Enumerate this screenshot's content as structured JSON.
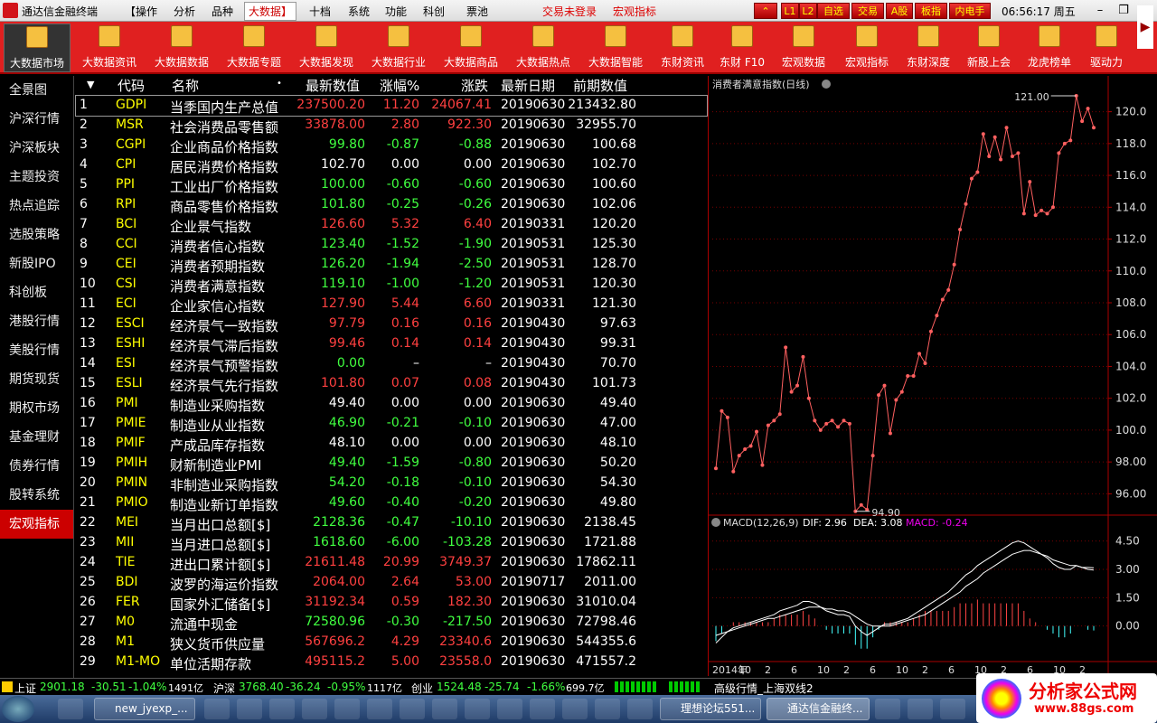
{
  "titlebar": {
    "title": "通达信金融终端",
    "menus": [
      "【操作",
      "分析",
      "品种",
      "大数据】",
      "十档",
      "系统",
      "功能",
      "科创",
      "票池"
    ],
    "login_status": "交易未登录",
    "macro_label": "宏观指标",
    "buttons": [
      "⌃",
      "L1",
      "L2",
      "自选",
      "交易",
      "A股",
      "板指",
      "内电手"
    ],
    "clock": "06:56:17",
    "weekday": "周五"
  },
  "toolbar": {
    "items": [
      "大数据市场",
      "大数据资讯",
      "大数据数据",
      "大数据专题",
      "大数据发现",
      "大数据行业",
      "大数据商品",
      "大数据热点",
      "大数据智能",
      "东财资讯",
      "东财 F10",
      "宏观数据",
      "宏观指标",
      "东财深度",
      "新股上会",
      "龙虎榜单",
      "驱动力"
    ]
  },
  "sidebar": {
    "items": [
      "全景图",
      "沪深行情",
      "沪深板块",
      "主题投资",
      "热点追踪",
      "选股策略",
      "新股IPO",
      "科创板",
      "港股行情",
      "美股行情",
      "期货现货",
      "期权市场",
      "基金理财",
      "债券行情",
      "股转系统",
      "宏观指标"
    ],
    "active_index": 15
  },
  "table": {
    "headers": {
      "sort": "▼",
      "code": "代码",
      "name": "名称",
      "dot": "•",
      "value": "最新数值",
      "pct": "涨幅%",
      "chg": "涨跌",
      "date": "最新日期",
      "prev": "前期数值"
    },
    "rows": [
      {
        "no": "1",
        "code": "GDPI",
        "name": "当季国内生产总值",
        "value": "237500.20",
        "pct": "11.20",
        "chg": "24067.41",
        "date": "20190630",
        "prev": "213432.80",
        "dir": "up"
      },
      {
        "no": "2",
        "code": "MSR",
        "name": "社会消费品零售额",
        "value": "33878.00",
        "pct": "2.80",
        "chg": "922.30",
        "date": "20190630",
        "prev": "32955.70",
        "dir": "up"
      },
      {
        "no": "3",
        "code": "CGPI",
        "name": "企业商品价格指数",
        "value": "99.80",
        "pct": "-0.87",
        "chg": "-0.88",
        "date": "20190630",
        "prev": "100.68",
        "dir": "dn"
      },
      {
        "no": "4",
        "code": "CPI",
        "name": "居民消费价格指数",
        "value": "102.70",
        "pct": "0.00",
        "chg": "0.00",
        "date": "20190630",
        "prev": "102.70",
        "dir": "fl"
      },
      {
        "no": "5",
        "code": "PPI",
        "name": "工业出厂价格指数",
        "value": "100.00",
        "pct": "-0.60",
        "chg": "-0.60",
        "date": "20190630",
        "prev": "100.60",
        "dir": "dn"
      },
      {
        "no": "6",
        "code": "RPI",
        "name": "商品零售价格指数",
        "value": "101.80",
        "pct": "-0.25",
        "chg": "-0.26",
        "date": "20190630",
        "prev": "102.06",
        "dir": "dn"
      },
      {
        "no": "7",
        "code": "BCI",
        "name": "企业景气指数",
        "value": "126.60",
        "pct": "5.32",
        "chg": "6.40",
        "date": "20190331",
        "prev": "120.20",
        "dir": "up"
      },
      {
        "no": "8",
        "code": "CCI",
        "name": "消费者信心指数",
        "value": "123.40",
        "pct": "-1.52",
        "chg": "-1.90",
        "date": "20190531",
        "prev": "125.30",
        "dir": "dn"
      },
      {
        "no": "9",
        "code": "CEI",
        "name": "消费者预期指数",
        "value": "126.20",
        "pct": "-1.94",
        "chg": "-2.50",
        "date": "20190531",
        "prev": "128.70",
        "dir": "dn"
      },
      {
        "no": "10",
        "code": "CSI",
        "name": "消费者满意指数",
        "value": "119.10",
        "pct": "-1.00",
        "chg": "-1.20",
        "date": "20190531",
        "prev": "120.30",
        "dir": "dn"
      },
      {
        "no": "11",
        "code": "ECI",
        "name": "企业家信心指数",
        "value": "127.90",
        "pct": "5.44",
        "chg": "6.60",
        "date": "20190331",
        "prev": "121.30",
        "dir": "up"
      },
      {
        "no": "12",
        "code": "ESCI",
        "name": "经济景气一致指数",
        "value": "97.79",
        "pct": "0.16",
        "chg": "0.16",
        "date": "20190430",
        "prev": "97.63",
        "dir": "up"
      },
      {
        "no": "13",
        "code": "ESHI",
        "name": "经济景气滞后指数",
        "value": "99.46",
        "pct": "0.14",
        "chg": "0.14",
        "date": "20190430",
        "prev": "99.31",
        "dir": "up"
      },
      {
        "no": "14",
        "code": "ESI",
        "name": "经济景气预警指数",
        "value": "0.00",
        "pct": "–",
        "chg": "–",
        "date": "20190430",
        "prev": "70.70",
        "dir": "fl",
        "valdir": "dn"
      },
      {
        "no": "15",
        "code": "ESLI",
        "name": "经济景气先行指数",
        "value": "101.80",
        "pct": "0.07",
        "chg": "0.08",
        "date": "20190430",
        "prev": "101.73",
        "dir": "up"
      },
      {
        "no": "16",
        "code": "PMI",
        "name": "制造业采购指数",
        "value": "49.40",
        "pct": "0.00",
        "chg": "0.00",
        "date": "20190630",
        "prev": "49.40",
        "dir": "fl"
      },
      {
        "no": "17",
        "code": "PMIE",
        "name": "制造业从业指数",
        "value": "46.90",
        "pct": "-0.21",
        "chg": "-0.10",
        "date": "20190630",
        "prev": "47.00",
        "dir": "dn"
      },
      {
        "no": "18",
        "code": "PMIF",
        "name": "产成品库存指数",
        "value": "48.10",
        "pct": "0.00",
        "chg": "0.00",
        "date": "20190630",
        "prev": "48.10",
        "dir": "fl"
      },
      {
        "no": "19",
        "code": "PMIH",
        "name": "财新制造业PMI",
        "value": "49.40",
        "pct": "-1.59",
        "chg": "-0.80",
        "date": "20190630",
        "prev": "50.20",
        "dir": "dn"
      },
      {
        "no": "20",
        "code": "PMIN",
        "name": "非制造业采购指数",
        "value": "54.20",
        "pct": "-0.18",
        "chg": "-0.10",
        "date": "20190630",
        "prev": "54.30",
        "dir": "dn"
      },
      {
        "no": "21",
        "code": "PMIO",
        "name": "制造业新订单指数",
        "value": "49.60",
        "pct": "-0.40",
        "chg": "-0.20",
        "date": "20190630",
        "prev": "49.80",
        "dir": "dn"
      },
      {
        "no": "22",
        "code": "MEI",
        "name": "当月出口总额[$]",
        "value": "2128.36",
        "pct": "-0.47",
        "chg": "-10.10",
        "date": "20190630",
        "prev": "2138.45",
        "dir": "dn"
      },
      {
        "no": "23",
        "code": "MII",
        "name": "当月进口总额[$]",
        "value": "1618.60",
        "pct": "-6.00",
        "chg": "-103.28",
        "date": "20190630",
        "prev": "1721.88",
        "dir": "dn"
      },
      {
        "no": "24",
        "code": "TIE",
        "name": "进出口累计额[$]",
        "value": "21611.48",
        "pct": "20.99",
        "chg": "3749.37",
        "date": "20190630",
        "prev": "17862.11",
        "dir": "up"
      },
      {
        "no": "25",
        "code": "BDI",
        "name": "波罗的海运价指数",
        "value": "2064.00",
        "pct": "2.64",
        "chg": "53.00",
        "date": "20190717",
        "prev": "2011.00",
        "dir": "up"
      },
      {
        "no": "26",
        "code": "FER",
        "name": "国家外汇储备[$]",
        "value": "31192.34",
        "pct": "0.59",
        "chg": "182.30",
        "date": "20190630",
        "prev": "31010.04",
        "dir": "up"
      },
      {
        "no": "27",
        "code": "M0",
        "name": "流通中现金",
        "value": "72580.96",
        "pct": "-0.30",
        "chg": "-217.50",
        "date": "20190630",
        "prev": "72798.46",
        "dir": "dn"
      },
      {
        "no": "28",
        "code": "M1",
        "name": "狭义货币供应量",
        "value": "567696.2",
        "pct": "4.29",
        "chg": "23340.6",
        "date": "20190630",
        "prev": "544355.6",
        "dir": "up"
      },
      {
        "no": "29",
        "code": "M1-MO",
        "name": "单位活期存款",
        "value": "495115.2",
        "pct": "5.00",
        "chg": "23558.0",
        "date": "20190630",
        "prev": "471557.2",
        "dir": "up"
      }
    ]
  },
  "chart_data": [
    {
      "type": "line",
      "title": "消费者满意指数(日线)",
      "ylim": [
        95,
        121
      ],
      "yticks": [
        "120.0",
        "118.0",
        "116.0",
        "114.0",
        "112.0",
        "110.0",
        "108.0",
        "106.0",
        "104.0",
        "102.0",
        "100.0",
        "98.00",
        "96.00"
      ],
      "annotations": {
        "max": "121.00",
        "min": "94.90"
      },
      "color": "#ff6060",
      "values": [
        97.6,
        101.2,
        100.8,
        97.4,
        98.4,
        98.8,
        99.0,
        99.9,
        97.8,
        100.3,
        100.6,
        101.0,
        105.2,
        102.4,
        102.8,
        104.6,
        102.0,
        100.6,
        100.0,
        100.4,
        100.6,
        100.2,
        100.6,
        100.4,
        94.9,
        95.3,
        95.0,
        98.4,
        102.2,
        102.8,
        99.8,
        101.9,
        102.4,
        103.4,
        103.4,
        104.8,
        104.2,
        106.2,
        107.2,
        108.2,
        108.8,
        110.4,
        112.6,
        114.2,
        115.8,
        116.2,
        118.6,
        117.2,
        118.4,
        117.0,
        119.0,
        117.2,
        117.4,
        113.6,
        115.6,
        113.5,
        113.8,
        113.6,
        114.0,
        117.4,
        118.0,
        118.2,
        121.0,
        119.4,
        120.2,
        119.0
      ]
    },
    {
      "type": "line",
      "title": "MACD(12,26,9)",
      "indicators": {
        "dif": "DIF: 2.96",
        "dea": "DEA: 3.08",
        "macd": "MACD: -0.24"
      },
      "ylim": [
        -1.5,
        5.2
      ],
      "yticks": [
        "4.50",
        "3.00",
        "1.50",
        "0.00"
      ],
      "xticks": [
        "2014年",
        "10",
        "2",
        "6",
        "10",
        "2",
        "6",
        "10",
        "2",
        "6",
        "10",
        "2",
        "6",
        "10",
        "2"
      ],
      "series": [
        {
          "values": [
            -0.9,
            -0.6,
            -0.3,
            -0.1,
            0.0,
            0.1,
            0.2,
            0.3,
            0.4,
            0.5,
            0.6,
            0.8,
            0.9,
            1.0,
            1.1,
            1.3,
            1.3,
            1.2,
            1.0,
            0.8,
            0.7,
            0.6,
            0.6,
            0.5,
            0.0,
            -0.3,
            -0.5,
            -0.3,
            -0.1,
            0.1,
            0.1,
            0.2,
            0.3,
            0.4,
            0.6,
            0.8,
            1.0,
            1.2,
            1.4,
            1.6,
            1.8,
            2.1,
            2.4,
            2.7,
            2.9,
            3.2,
            3.4,
            3.6,
            3.8,
            4.0,
            4.2,
            4.4,
            4.5,
            4.4,
            4.2,
            4.0,
            3.8,
            3.6,
            3.3,
            3.1,
            3.0,
            3.0,
            3.2,
            3.1,
            3.0,
            2.96
          ]
        },
        {
          "values": [
            -0.5,
            -0.4,
            -0.3,
            -0.2,
            -0.1,
            0.0,
            0.1,
            0.2,
            0.3,
            0.4,
            0.4,
            0.5,
            0.6,
            0.7,
            0.8,
            0.9,
            1.0,
            1.0,
            1.0,
            0.9,
            0.9,
            0.8,
            0.8,
            0.7,
            0.5,
            0.3,
            0.1,
            0.0,
            0.0,
            0.0,
            0.0,
            0.1,
            0.2,
            0.3,
            0.4,
            0.5,
            0.6,
            0.8,
            1.0,
            1.2,
            1.4,
            1.6,
            1.8,
            2.1,
            2.3,
            2.5,
            2.8,
            3.0,
            3.2,
            3.4,
            3.6,
            3.8,
            3.9,
            4.0,
            4.0,
            3.9,
            3.8,
            3.7,
            3.5,
            3.4,
            3.3,
            3.2,
            3.2,
            3.1,
            3.1,
            3.08
          ]
        }
      ]
    }
  ],
  "status": {
    "sh_label": "上证",
    "sh_val": "2901.18",
    "sh_chg": "-30.51",
    "sh_pct": "-1.04%",
    "sh_amt": "1491亿",
    "sz_label": "沪深",
    "sz_val": "3768.40",
    "sz_chg": "-36.24",
    "sz_pct": "-0.95%",
    "sz_amt": "1117亿",
    "cy_label": "创业",
    "cy_val": "1524.48",
    "cy_chg": "-25.74",
    "cy_pct": "-1.66%",
    "cy_amt": "699.7亿",
    "ticker": "高级行情_上海双线2"
  },
  "taskbar": {
    "items": [
      "new_jyexp_...",
      "理想论坛551...",
      "通达信金融终..."
    ]
  },
  "brand": {
    "text": "分析家公式网",
    "url": "www.88gs.com"
  }
}
